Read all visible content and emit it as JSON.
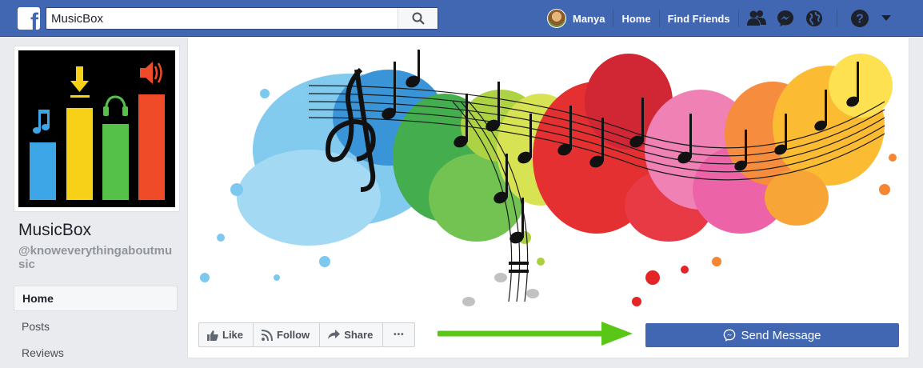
{
  "topbar": {
    "logo": "f",
    "search_value": "MusicBox",
    "user_name": "Manya",
    "home_label": "Home",
    "find_friends_label": "Find Friends",
    "icons": [
      "friend-requests-icon",
      "messenger-icon",
      "notifications-globe-icon",
      "help-icon",
      "caret-down-icon"
    ]
  },
  "page": {
    "name": "MusicBox",
    "handle": "@knoweverythingaboutmusic"
  },
  "sidebar": {
    "items": [
      {
        "label": "Home",
        "active": true
      },
      {
        "label": "Posts",
        "active": false
      },
      {
        "label": "Reviews",
        "active": false
      }
    ]
  },
  "actions": {
    "like_label": "Like",
    "follow_label": "Follow",
    "share_label": "Share",
    "more_label": "•••",
    "send_message_label": "Send Message"
  },
  "colors": {
    "brand": "#4267b2",
    "arrow": "#5ac718"
  }
}
